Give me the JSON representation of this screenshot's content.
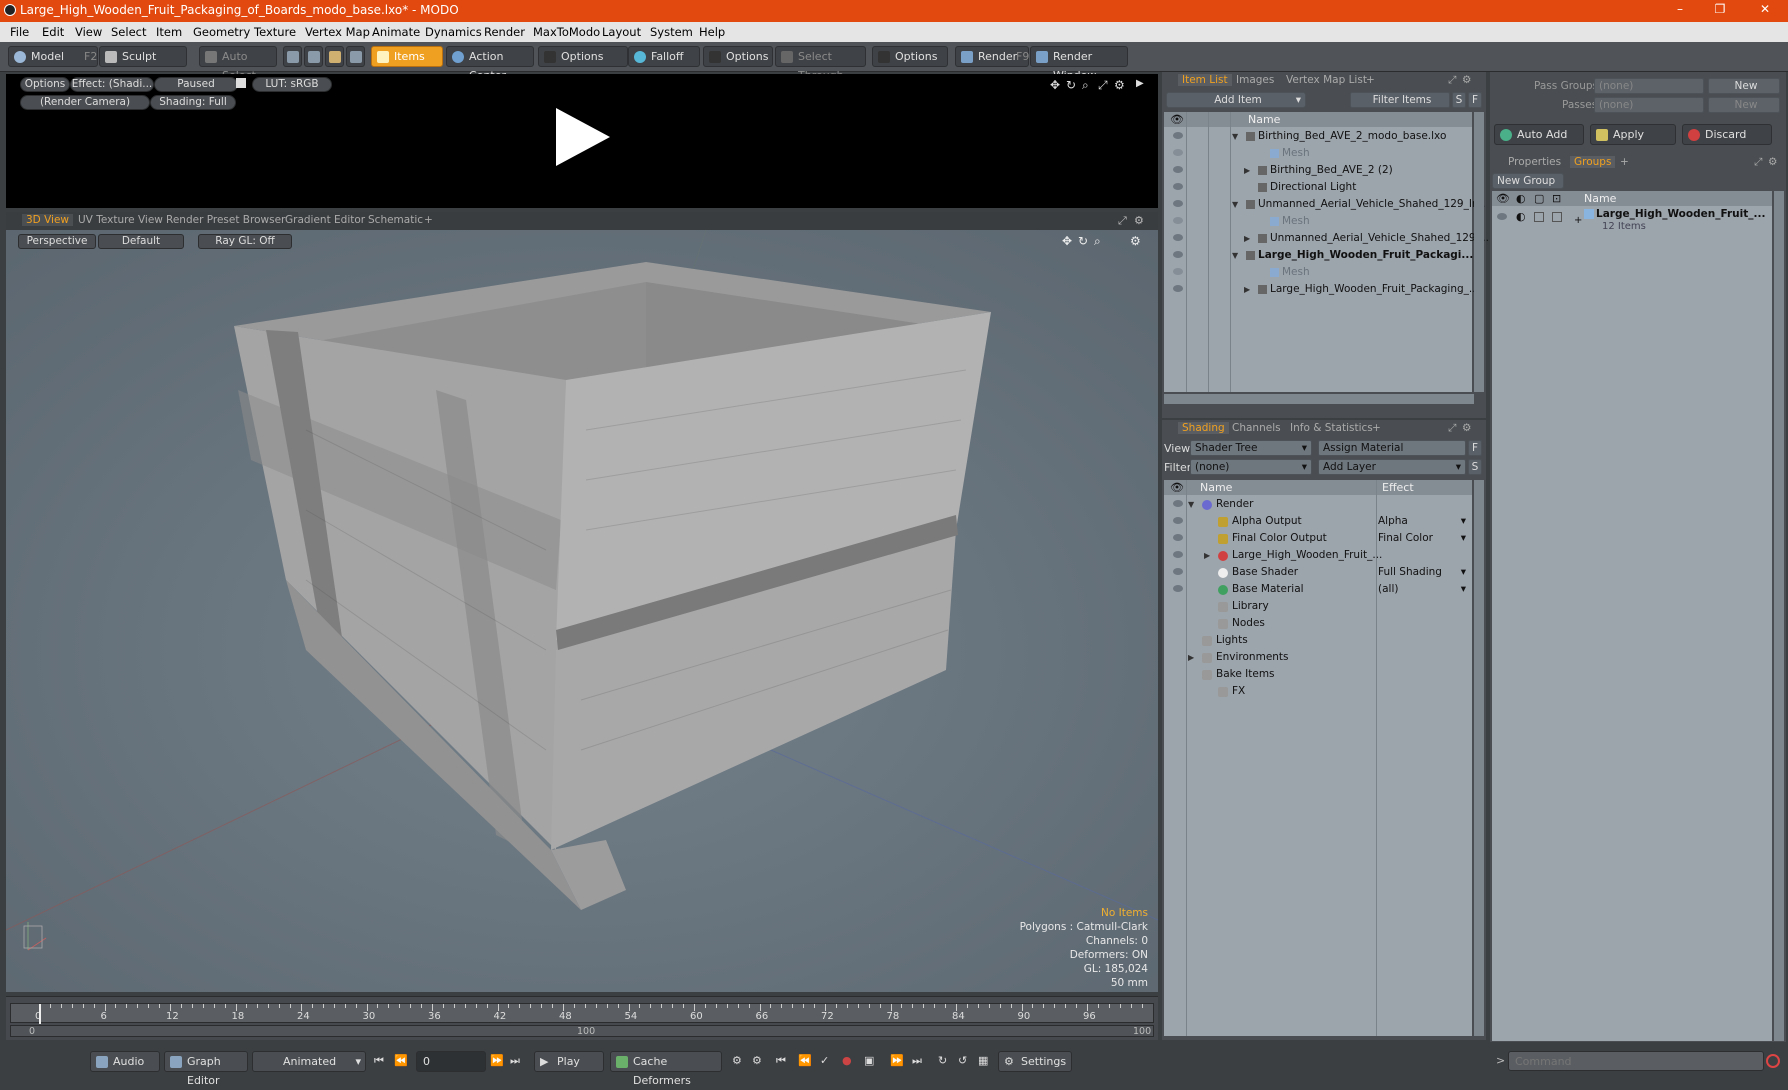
{
  "window": {
    "title": "Large_High_Wooden_Fruit_Packaging_of_Boards_modo_base.lxo* - MODO"
  },
  "menu": [
    "File",
    "Edit",
    "View",
    "Select",
    "Item",
    "Geometry",
    "Texture",
    "Vertex Map",
    "Animate",
    "Dynamics",
    "Render",
    "MaxToModo",
    "Layout",
    "System",
    "Help"
  ],
  "toolbar": {
    "model": "Model",
    "model_key": "F2",
    "sculpt": "Sculpt",
    "auto_select": "Auto Select",
    "items": "Items",
    "action_center": "Action Center",
    "options1": "Options",
    "falloff": "Falloff",
    "options2": "Options",
    "select_through": "Select Through",
    "options3": "Options",
    "render": "Render",
    "render_key": "F9",
    "render_window": "Render Window"
  },
  "preview": {
    "options": "Options",
    "effect": "Effect: (Shadi...",
    "paused": "Paused",
    "lut": "LUT: sRGB",
    "camera": "(Render Camera)",
    "shading": "Shading: Full"
  },
  "viewport_tabs": [
    "3D View",
    "UV Texture View",
    "Render Preset Browser",
    "Gradient Editor",
    "Schematic",
    "+"
  ],
  "viewport": {
    "perspective": "Perspective",
    "default": "Default",
    "raygl": "Ray GL: Off",
    "stats": {
      "no_items": "No Items",
      "polygons": "Polygons : Catmull-Clark",
      "channels": "Channels: 0",
      "deformers": "Deformers: ON",
      "gl": "GL: 185,024",
      "lens": "50 mm"
    }
  },
  "timeline": {
    "ticks": [
      "0",
      "6",
      "12",
      "18",
      "24",
      "30",
      "36",
      "42",
      "48",
      "54",
      "60",
      "66",
      "72",
      "78",
      "84",
      "90",
      "96"
    ],
    "sub_start": "0",
    "sub_mid": "100",
    "sub_end": "100"
  },
  "bottom": {
    "audio": "Audio",
    "graph_editor": "Graph Editor",
    "animated": "Animated",
    "frame": "0",
    "play": "Play",
    "cache": "Cache Deformers",
    "settings": "Settings",
    "command_placeholder": "Command"
  },
  "item_list": {
    "tabs": [
      "Item List",
      "Images",
      "Vertex Map List",
      "+"
    ],
    "add_item": "Add Item",
    "filter_items": "Filter Items",
    "s": "S",
    "f": "F",
    "col_name": "Name",
    "rows": [
      {
        "label": "Birthing_Bed_AVE_2_modo_base.lxo",
        "indent": 0,
        "arrow": "▼",
        "bold": false,
        "dim": false
      },
      {
        "label": "Mesh",
        "indent": 2,
        "arrow": "",
        "bold": false,
        "dim": true
      },
      {
        "label": "Birthing_Bed_AVE_2 (2)",
        "indent": 1,
        "arrow": "▶",
        "bold": false,
        "dim": false
      },
      {
        "label": "Directional Light",
        "indent": 1,
        "arrow": "",
        "bold": false,
        "dim": false
      },
      {
        "label": "Unmanned_Aerial_Vehicle_Shahed_129_Ir...",
        "indent": 0,
        "arrow": "▼",
        "bold": false,
        "dim": false
      },
      {
        "label": "Mesh",
        "indent": 2,
        "arrow": "",
        "bold": false,
        "dim": true
      },
      {
        "label": "Unmanned_Aerial_Vehicle_Shahed_129 ...",
        "indent": 1,
        "arrow": "▶",
        "bold": false,
        "dim": false
      },
      {
        "label": "Large_High_Wooden_Fruit_Packagi...",
        "indent": 0,
        "arrow": "▼",
        "bold": true,
        "dim": false
      },
      {
        "label": "Mesh",
        "indent": 2,
        "arrow": "",
        "bold": false,
        "dim": true
      },
      {
        "label": "Large_High_Wooden_Fruit_Packaging_...",
        "indent": 1,
        "arrow": "▶",
        "bold": false,
        "dim": false
      }
    ]
  },
  "shading": {
    "tabs": [
      "Shading",
      "Channels",
      "Info & Statistics",
      "+"
    ],
    "view_label": "View",
    "view_value": "Shader Tree",
    "assign_material": "Assign Material",
    "filter_label": "Filter",
    "filter_value": "(none)",
    "add_layer": "Add Layer",
    "col_name": "Name",
    "col_effect": "Effect",
    "rows": [
      {
        "label": "Render",
        "effect": "",
        "indent": 0,
        "arrow": "▼"
      },
      {
        "label": "Alpha Output",
        "effect": "Alpha",
        "indent": 1,
        "arrow": ""
      },
      {
        "label": "Final Color Output",
        "effect": "Final Color",
        "indent": 1,
        "arrow": ""
      },
      {
        "label": "Large_High_Wooden_Fruit_...",
        "effect": "",
        "indent": 1,
        "arrow": "▶"
      },
      {
        "label": "Base Shader",
        "effect": "Full Shading",
        "indent": 1,
        "arrow": ""
      },
      {
        "label": "Base Material",
        "effect": "(all)",
        "indent": 1,
        "arrow": ""
      },
      {
        "label": "Library",
        "effect": "",
        "indent": 1,
        "arrow": ""
      },
      {
        "label": "Nodes",
        "effect": "",
        "indent": 1,
        "arrow": ""
      },
      {
        "label": "Lights",
        "effect": "",
        "indent": 0,
        "arrow": ""
      },
      {
        "label": "Environments",
        "effect": "",
        "indent": 0,
        "arrow": "▶"
      },
      {
        "label": "Bake Items",
        "effect": "",
        "indent": 0,
        "arrow": ""
      },
      {
        "label": "FX",
        "effect": "",
        "indent": 1,
        "arrow": ""
      }
    ]
  },
  "right": {
    "pass_groups": "Pass Groups",
    "passes": "Passes",
    "none": "(none)",
    "new": "New",
    "auto_add": "Auto Add",
    "apply": "Apply",
    "discard": "Discard",
    "tabs": [
      "Properties",
      "Groups",
      "+"
    ],
    "new_group": "New Group",
    "col_name": "Name",
    "group_name": "Large_High_Wooden_Fruit_...",
    "group_count": "12 Items"
  }
}
